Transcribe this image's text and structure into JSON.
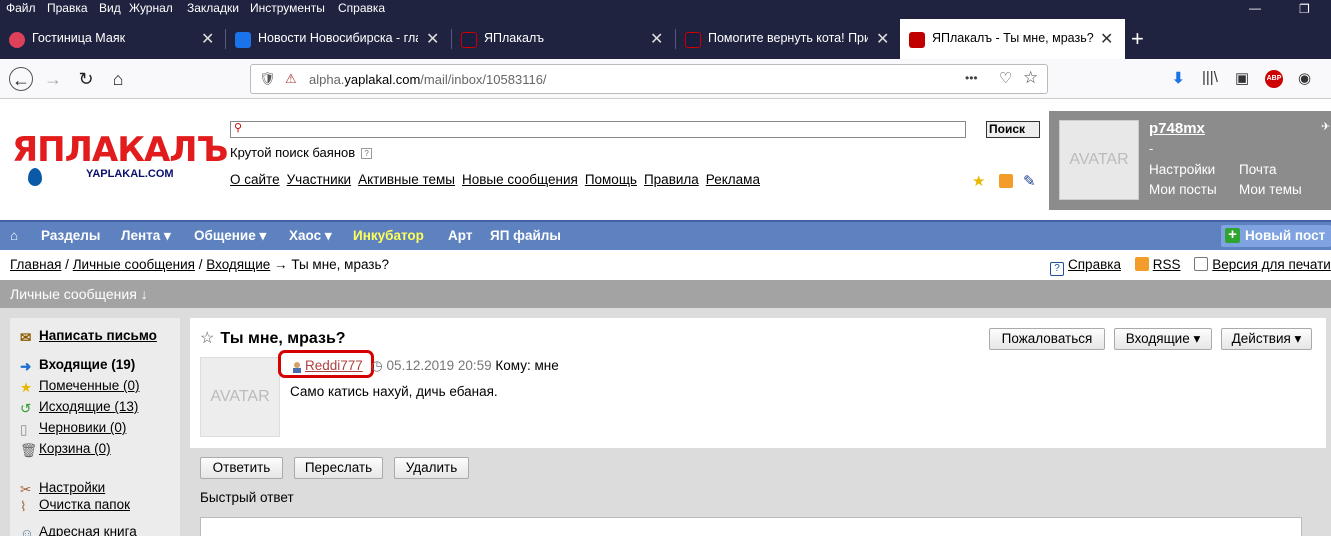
{
  "menubar": {
    "items": [
      "Файл",
      "Правка",
      "Вид",
      "Журнал",
      "Закладки",
      "Инструменты",
      "Справка"
    ],
    "minimize": "—",
    "maximize": "❐"
  },
  "tabs": [
    {
      "label": "Гостиница Маяк",
      "favicon_color": "#e0405a"
    },
    {
      "label": "Новости Новосибирска - главн",
      "favicon_color": "#1a73e8"
    },
    {
      "label": "ЯПлакалъ",
      "favicon_color": "#c00000"
    },
    {
      "label": "Помогите вернуть кота! Прин",
      "favicon_color": "#c00000"
    },
    {
      "label": "ЯПлакалъ - Ты мне, мразь?",
      "favicon_color": "#c00000"
    }
  ],
  "navbar": {
    "url_host": "alpha.",
    "url_domain": "yaplakal.com",
    "url_path": "/mail/inbox/10583116/",
    "ellipsis": "•••"
  },
  "site": {
    "logo_main": "ЯПЛАКАЛЪ",
    "logo_sub": "YAPLAKAL.COM",
    "search_button": "Поиск",
    "search_caption": "Крутой поиск баянов",
    "help_mark": "?",
    "top_links": [
      "О сайте",
      "Участники",
      "Активные темы",
      "Новые сообщения",
      "Помощь",
      "Правила",
      "Реклама"
    ]
  },
  "user": {
    "avatar_text": "AVATAR",
    "username": "p748mx",
    "dash": "-",
    "links": [
      "Настройки",
      "Почта",
      "Мои посты",
      "Мои темы"
    ]
  },
  "bluemenu": {
    "home_icon": "⌂",
    "items": [
      "Разделы",
      "Лента ▾",
      "Общение ▾",
      "Хаос ▾",
      "Инкубатор",
      "Арт",
      "ЯП файлы"
    ],
    "new_post": "Новый пост"
  },
  "breadcrumb": {
    "parts": [
      "Главная",
      "Личные сообщения",
      "Входящие"
    ],
    "sep": "/",
    "arrow": "→",
    "current": "Ты мне, мразь?"
  },
  "rightlinks": [
    "Справка",
    "RSS",
    "Версия для печати"
  ],
  "section_header": "Личные сообщения ↓",
  "sidebar": {
    "compose": "Написать письмо",
    "folders": [
      "Входящие (19)",
      "Помеченные (0)",
      "Исходящие (13)",
      "Черновики (0)",
      "Корзина (0)"
    ],
    "settings": "Настройки",
    "clean": "Очистка папок",
    "addressbook": "Адресная книга"
  },
  "message": {
    "title": "Ты мне, мразь?",
    "star": "☆",
    "buttons": {
      "report": "Пожаловаться",
      "inbox": "Входящие ▾",
      "actions": "Действия ▾"
    },
    "avatar_text": "AVATAR",
    "sender": "Reddi777",
    "clock": "◷",
    "date": "05.12.2019 20:59",
    "to": "Кому: мне",
    "body": "Само катись нахуй, дичь ебаная."
  },
  "actions": {
    "reply": "Ответить",
    "forward": "Переслать",
    "delete": "Удалить"
  },
  "quick_reply": "Быстрый ответ"
}
